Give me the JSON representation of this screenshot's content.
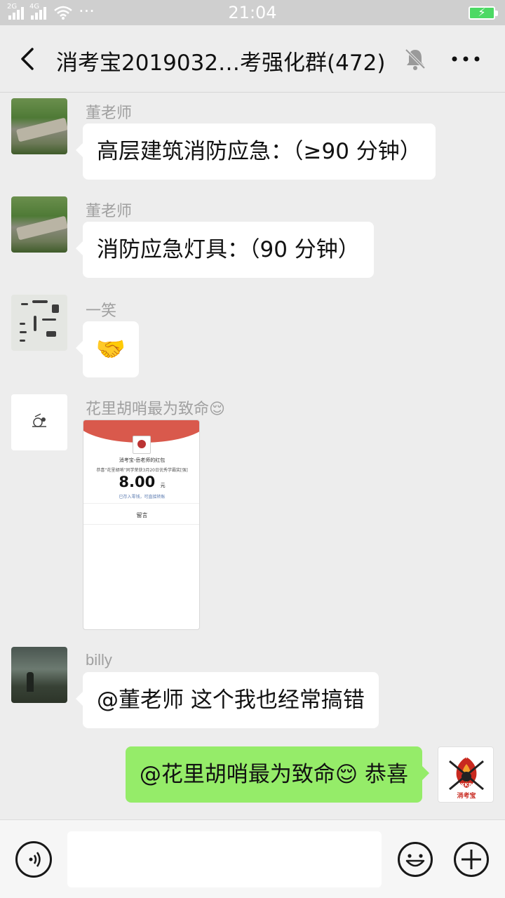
{
  "status_bar": {
    "time": "21:04",
    "network_1": "2G",
    "network_2": "4G",
    "more_dots": "···"
  },
  "header": {
    "title": "消考宝2019032…考强化群(472)"
  },
  "messages": [
    {
      "sender": "董老师",
      "text": "高层建筑消防应急：（≥90 分钟）"
    },
    {
      "sender": "董老师",
      "text": "消防应急灯具：（90 分钟）"
    },
    {
      "sender": "一笑",
      "text": "🤝"
    },
    {
      "sender": "花里胡哨最为致命😌",
      "red_packet": {
        "title": "消考宝-岳老师的红包",
        "subtitle": "恭喜“花里胡哨”同学荣获3月20日优秀学霸奖[强]",
        "amount": "8.00",
        "unit": "元",
        "note": "已存入零钱，可直接转账",
        "reply": "留言"
      }
    },
    {
      "sender": "billy",
      "text": "@董老师  这个我也经常搞错"
    },
    {
      "sender": "me",
      "text": "@花里胡哨最为致命😌  恭喜"
    }
  ],
  "my_avatar": {
    "label_top": "FIRE",
    "label_mid": "XKB",
    "label_bottom": "消考宝"
  },
  "input": {
    "placeholder": ""
  },
  "icons": {
    "back": "chevron-left-icon",
    "mute": "bell-muted-icon",
    "more": "more-dots-icon",
    "voice": "voice-icon",
    "emoji": "emoji-icon",
    "plus": "plus-icon"
  },
  "colors": {
    "my_bubble": "#95ec69",
    "battery": "#4cd964",
    "red_packet": "#d9594c"
  }
}
